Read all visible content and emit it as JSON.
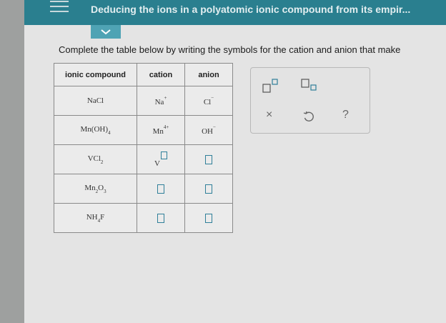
{
  "header": {
    "title": "Deducing the ions in a polyatomic ionic compound from its empir..."
  },
  "instructions": "Complete the table below by writing the symbols for the cation and anion that make",
  "table": {
    "headers": [
      "ionic compound",
      "cation",
      "anion"
    ],
    "rows": [
      {
        "compound": "NaCl",
        "cation_symbol": "Na",
        "cation_charge": "+",
        "anion_symbol": "Cl",
        "anion_charge": "−"
      },
      {
        "compound": "Mn(OH)",
        "compound_subscript": "4",
        "cation_symbol": "Mn",
        "cation_charge": "4+",
        "anion_symbol": "OH",
        "anion_charge": "−"
      },
      {
        "compound": "VCl",
        "compound_subscript": "2",
        "cation_symbol": "V",
        "cation_input": "",
        "anion_input": ""
      },
      {
        "compound_parts": [
          "Mn",
          "2",
          "O",
          "3"
        ],
        "cation_input": "",
        "anion_input": ""
      },
      {
        "compound_parts": [
          "NH",
          "4",
          "F"
        ],
        "cation_input": "",
        "anion_input": ""
      }
    ]
  },
  "palette": {
    "icons": [
      "superscript-template-icon",
      "subscript-template-icon",
      "clear-icon",
      "undo-icon",
      "help-icon"
    ],
    "clear_glyph": "×",
    "help_glyph": "?"
  },
  "colors": {
    "header_bg": "#2a7f8f",
    "tab_bg": "#4fa3b4",
    "input_border": "#2f7f99"
  }
}
